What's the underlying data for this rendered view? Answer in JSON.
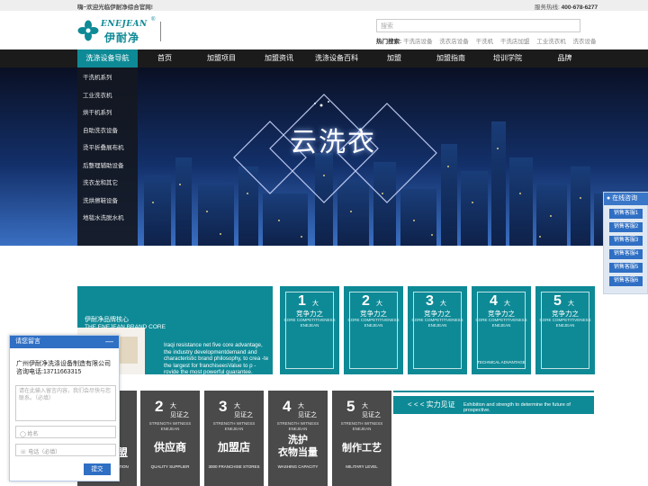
{
  "topbar": {
    "welcome": "嗨~欢迎光临伊耐净综合官网!",
    "hotline_label": "服务热线",
    "hotline_number": "400-678-6277"
  },
  "header": {
    "logo_en": "ENEJEAN",
    "logo_cn": "伊耐净",
    "logo_reg": "®",
    "search_placeholder": "搜索",
    "hot_label": "热门搜索:",
    "hot_words": [
      "干洗店设备",
      "洗衣店设备",
      "干洗机",
      "干洗店加盟",
      "工业洗衣机",
      "洗衣设备"
    ]
  },
  "nav": {
    "side_title": "洗涤设备导航",
    "items": [
      "首页",
      "加盟项目",
      "加盟资讯",
      "洗涤设备百科",
      "加盟",
      "加盟指南",
      "培训学院",
      "品牌"
    ]
  },
  "sidemenu": {
    "items": [
      "干洗机系列",
      "工业洗衣机",
      "烘干机系列",
      "自助洗衣设备",
      "烫平折叠展布机",
      "后整理辅助设备",
      "洗衣龙和其它",
      "洗烘擦鞋设备",
      "地毯水洗脱水机"
    ]
  },
  "hero": {
    "headline": "云洗衣"
  },
  "customer_service": {
    "title": "在线咨询",
    "agents": [
      "销售客服1",
      "销售客服2",
      "销售客服3",
      "销售客服4",
      "销售客服5",
      "销售客服6"
    ]
  },
  "brand": {
    "title_cn": "伊耐净品牌核心",
    "title_en": "THE ENEJEAN BRAND CORE",
    "desc": "Iraqi resistance net five core advantage, the industry developmentdemand and characteristic brand philosophy, to crea -te the largest for franchiseesValue to p -rovide the most powerful guarantee."
  },
  "advantages": [
    {
      "num": "1",
      "small": "大",
      "cn": "竞争力之",
      "en1": "CORE COMPETITIVENESS",
      "en2": "ENEJEAN",
      "foot": ""
    },
    {
      "num": "2",
      "small": "大",
      "cn": "竞争力之",
      "en1": "CORE COMPETITIVENESS",
      "en2": "ENEJEAN",
      "foot": ""
    },
    {
      "num": "3",
      "small": "大",
      "cn": "竞争力之",
      "en1": "CORE COMPETITIVENESS",
      "en2": "ENEJEAN",
      "foot": ""
    },
    {
      "num": "4",
      "small": "大",
      "cn": "竞争力之",
      "en1": "CORE COMPETITIVENESS",
      "en2": "ENEJEAN",
      "foot": "TECHNICAL ADVANTAGE"
    },
    {
      "num": "5",
      "small": "大",
      "cn": "竞争力之",
      "en1": "CORE COMPETITIVENESS",
      "en2": "ENEJEAN",
      "foot": ""
    }
  ],
  "witness": [
    {
      "num": "",
      "small": "",
      "sub": "",
      "en1": "",
      "en2": "",
      "big": "盟",
      "foot": "ATION"
    },
    {
      "num": "2",
      "small": "大",
      "sub": "见证之",
      "en1": "STRENGTH WITNESS",
      "en2": "ENEJEAN",
      "big": "供应商",
      "foot": "QUALITY SUPPLIER"
    },
    {
      "num": "3",
      "small": "大",
      "sub": "见证之",
      "en1": "STRENGTH WITNESS",
      "en2": "ENEJEAN",
      "big": "加盟店",
      "foot": "3000 FRANCHISE STORES"
    },
    {
      "num": "4",
      "small": "大",
      "sub": "见证之",
      "en1": "STRENGTH WITNESS",
      "en2": "ENEJEAN",
      "big": "洗护\n衣物当量",
      "foot": "WASHING CAPACITY"
    },
    {
      "num": "5",
      "small": "大",
      "sub": "见证之",
      "en1": "STRENGTH WITNESS",
      "en2": "ENEJEAN",
      "big": "制作工艺",
      "foot": "MILITARY LEVEL"
    }
  ],
  "strength": {
    "label": "< < < 实力见证",
    "en": "Exhibition and strength to determine the future of prospective."
  },
  "message": {
    "title": "请您留言",
    "minimize": "—",
    "company": "广州伊耐净洗涤设备制造有限公司",
    "phone": "咨询电话:13711663315",
    "textarea_placeholder": "请在此输入留言内容，我们会尽快与您联系。（必填）",
    "name_placeholder": "姓名",
    "tel_placeholder": "电话（必填）",
    "submit": "提交"
  },
  "colors": {
    "teal": "#0e8a96",
    "dark": "#1b1b1b",
    "gray": "#4a4a4a",
    "blue": "#2f6fc4"
  }
}
